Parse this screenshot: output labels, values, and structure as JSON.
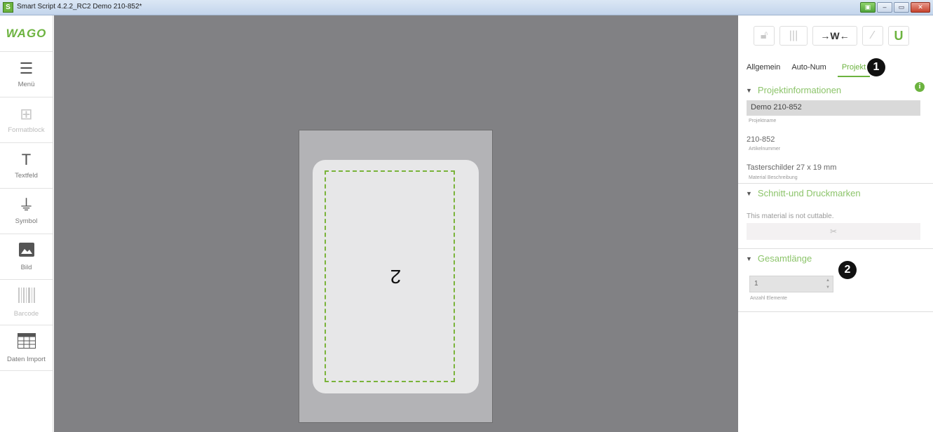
{
  "window": {
    "title": "Smart Script 4.2.2_RC2  Demo 210-852*",
    "app_icon": "S"
  },
  "leftbar": {
    "logo": "WAGO",
    "tools": [
      {
        "label": "Menü",
        "icon": "menu-icon",
        "glyph": "☰",
        "enabled": true
      },
      {
        "label": "Formatblock",
        "icon": "formatblock-icon",
        "glyph": "⊞",
        "enabled": false
      },
      {
        "label": "Textfeld",
        "icon": "text-icon",
        "glyph": "T",
        "enabled": true
      },
      {
        "label": "Symbol",
        "icon": "ground-symbol-icon",
        "glyph": "⏚",
        "enabled": true
      },
      {
        "label": "Bild",
        "icon": "image-icon",
        "glyph": "🖼",
        "enabled": true
      },
      {
        "label": "Barcode",
        "icon": "barcode-icon",
        "glyph": "▥",
        "enabled": false
      },
      {
        "label": "Daten Import",
        "icon": "table-import-icon",
        "glyph": "▦",
        "enabled": true
      }
    ]
  },
  "canvas": {
    "label_text": "2"
  },
  "rightpanel": {
    "tabs": [
      {
        "label": "Allgemein",
        "active": false
      },
      {
        "label": "Auto-Num",
        "active": false
      },
      {
        "label": "Projekt",
        "active": true
      }
    ],
    "badges": [
      "1",
      "2"
    ],
    "project_section": {
      "title": "Projektinformationen",
      "project_name_value": "Demo 210-852",
      "project_name_label": "Projektname",
      "article_value": "210-852",
      "article_label": "Artikelnummer",
      "material_value": "Tasterschilder  27 x 19  mm",
      "material_label": "Material Beschreibung"
    },
    "cut_section": {
      "title": "Schnitt-und Druckmarken",
      "note": "This material is not cuttable."
    },
    "length_section": {
      "title": "Gesamtlänge",
      "count_value": "1",
      "count_label": "Anzahl Elemente"
    }
  },
  "colors": {
    "accent": "#6cb33f",
    "canvas_bg": "#818184",
    "cutline": "#7ab33a"
  }
}
